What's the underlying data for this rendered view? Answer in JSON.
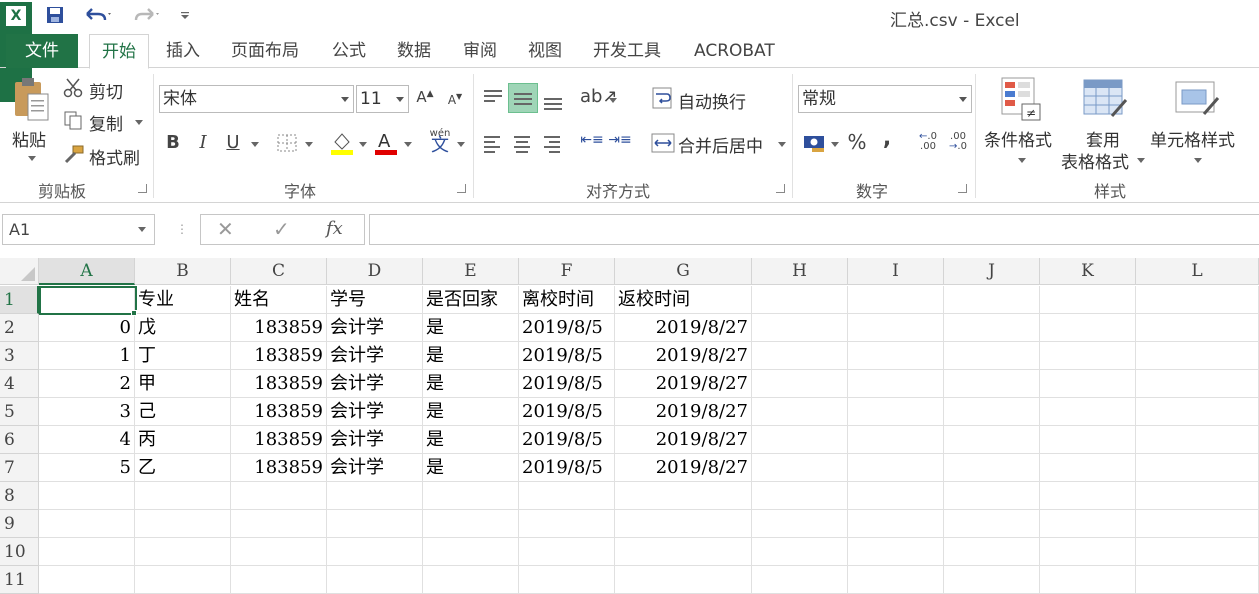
{
  "window": {
    "title": "汇总.csv - Excel"
  },
  "tabs": {
    "file": "文件",
    "items": [
      "开始",
      "插入",
      "页面布局",
      "公式",
      "数据",
      "审阅",
      "视图",
      "开发工具",
      "ACROBAT"
    ],
    "active_index": 0
  },
  "clipboard": {
    "paste": "粘贴",
    "cut": "剪切",
    "copy": "复制",
    "format_painter": "格式刷",
    "label": "剪贴板"
  },
  "font": {
    "name": "宋体",
    "size": "11",
    "bold": "B",
    "italic": "I",
    "underline": "U",
    "label": "字体",
    "phonetic": "wén"
  },
  "alignment": {
    "wrap_text": "自动换行",
    "merge_center": "合并后居中",
    "label": "对齐方式"
  },
  "number": {
    "format": "常规",
    "percent": "%",
    "comma": ",",
    "label": "数字"
  },
  "styles": {
    "conditional": "条件格式",
    "table_format_1": "套用",
    "table_format_2": "表格格式",
    "cell_styles": "单元格样式",
    "label": "样式"
  },
  "formula_bar": {
    "name_box": "A1",
    "fx": "fx",
    "value": ""
  },
  "sheet": {
    "columns": [
      "A",
      "B",
      "C",
      "D",
      "E",
      "F",
      "G",
      "H",
      "I",
      "J",
      "K",
      "L"
    ],
    "rows": [
      "1",
      "2",
      "3",
      "4",
      "5",
      "6",
      "7",
      "8",
      "9",
      "10",
      "11"
    ],
    "selected_cell": "A1",
    "data": [
      [
        "",
        "专业",
        "姓名",
        "学号",
        "是否回家",
        "离校时间",
        "返校时间"
      ],
      [
        "0",
        "戊",
        "183859",
        "会计学",
        "是",
        "2019/8/5",
        "2019/8/27"
      ],
      [
        "1",
        "丁",
        "183859",
        "会计学",
        "是",
        "2019/8/5",
        "2019/8/27"
      ],
      [
        "2",
        "甲",
        "183859",
        "会计学",
        "是",
        "2019/8/5",
        "2019/8/27"
      ],
      [
        "3",
        "己",
        "183859",
        "会计学",
        "是",
        "2019/8/5",
        "2019/8/27"
      ],
      [
        "4",
        "丙",
        "183859",
        "会计学",
        "是",
        "2019/8/5",
        "2019/8/27"
      ],
      [
        "5",
        "乙",
        "183859",
        "会计学",
        "是",
        "2019/8/5",
        "2019/8/27"
      ]
    ]
  },
  "colors": {
    "accent": "#217346",
    "ribbon_bg": "#ffffff",
    "grid_line": "#e0e0e0"
  }
}
